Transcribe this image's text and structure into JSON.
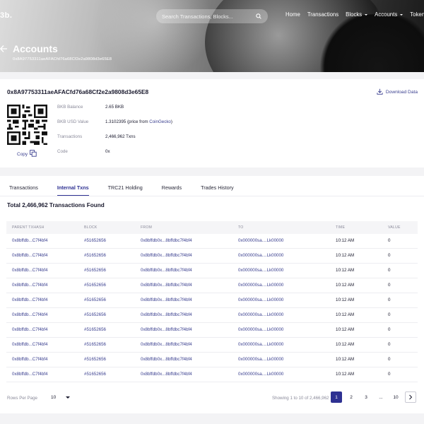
{
  "header": {
    "logo": "3b.",
    "search_placeholder": "Search Transactions, Blocks...",
    "nav": [
      {
        "label": "Home",
        "dropdown": false
      },
      {
        "label": "Transactions",
        "dropdown": false
      },
      {
        "label": "Blocks",
        "dropdown": true
      },
      {
        "label": "Accounts",
        "dropdown": true
      },
      {
        "label": "Tokens",
        "dropdown": true
      }
    ],
    "title": "Accounts",
    "subtitle": "0x8A97753311aeAFACfd76a68Cf2e2a9808d3e65E8"
  },
  "account": {
    "address": "0x8A97753311aeAFACfd76a68Cf2e2a9808d3e65E8",
    "download_label": "Download Data",
    "copy_label": "Copy",
    "rows": [
      {
        "key": "BKB Balance",
        "value": "2.65 BKB"
      },
      {
        "key": "BKB USD Value",
        "value": "1.3102395 (price from ",
        "link": "CoinGecko",
        "after": ")"
      },
      {
        "key": "Transactions",
        "value": "2,466,962 Txns"
      },
      {
        "key": "Code",
        "value": "0x"
      }
    ]
  },
  "tabs": [
    {
      "label": "Transactions",
      "active": false
    },
    {
      "label": "Internal Txns",
      "active": true
    },
    {
      "label": "TRC21 Holding",
      "active": false
    },
    {
      "label": "Rewards",
      "active": false
    },
    {
      "label": "Trades History",
      "active": false
    }
  ],
  "total_label": "Total 2,466,962 Transactions Found",
  "table": {
    "columns": [
      "PARENT TXHASH",
      "BLOCK",
      "FROM",
      "TO",
      "TIME",
      "VALUE"
    ],
    "rows": [
      [
        "0x8bffdb...C7f4bf4",
        "#51652656",
        "0x8bffdb0x...8bffdbc7f4bf4",
        "0x000000sa....Lk00000",
        "10:12 AM",
        "0"
      ],
      [
        "0x8bffdb...C7f4bf4",
        "#51652656",
        "0x8bffdb0x...8bffdbc7f4bf4",
        "0x000000sa....Lk00000",
        "10:12 AM",
        "0"
      ],
      [
        "0x8bffdb...C7f4bf4",
        "#51652656",
        "0x8bffdb0x...8bffdbc7f4bf4",
        "0x000000sa....Lk00000",
        "10:12 AM",
        "0"
      ],
      [
        "0x8bffdb...C7f4bf4",
        "#51652656",
        "0x8bffdb0x...8bffdbc7f4bf4",
        "0x000000sa....Lk00000",
        "10:12 AM",
        "0"
      ],
      [
        "0x8bffdb...C7f4bf4",
        "#51652656",
        "0x8bffdb0x...8bffdbc7f4bf4",
        "0x000000sa....Lk00000",
        "10:12 AM",
        "0"
      ],
      [
        "0x8bffdb...C7f4bf4",
        "#51652656",
        "0x8bffdb0x...8bffdbc7f4bf4",
        "0x000000sa....Lk00000",
        "10:12 AM",
        "0"
      ],
      [
        "0x8bffdb...C7f4bf4",
        "#51652656",
        "0x8bffdb0x...8bffdbc7f4bf4",
        "0x000000sa....Lk00000",
        "10:12 AM",
        "0"
      ],
      [
        "0x8bffdb...C7f4bf4",
        "#51652656",
        "0x8bffdb0x...8bffdbc7f4bf4",
        "0x000000sa....Lk00000",
        "10:12 AM",
        "0"
      ],
      [
        "0x8bffdb...C7f4bf4",
        "#51652656",
        "0x8bffdb0x...8bffdbc7f4bf4",
        "0x000000sa....Lk00000",
        "10:12 AM",
        "0"
      ],
      [
        "0x8bffdb...C7f4bf4",
        "#51652656",
        "0x8bffdb0x...8bffdbc7f4bf4",
        "0x000000sa....Lk00000",
        "10:12 AM",
        "0"
      ]
    ]
  },
  "pagination": {
    "rows_per_page_label": "Rows Per Page",
    "rows_per_page": "10",
    "showing": "Showing 1 to 10 of 2,466,962",
    "pages": [
      "1",
      "2",
      "3",
      "...",
      "10"
    ],
    "active_page": "1"
  },
  "icons": {
    "search": "search-icon",
    "back": "arrow-left-icon",
    "download": "download-icon",
    "copy": "copy-icon",
    "next": "chevron-right-icon",
    "qr": "qr-code-icon"
  },
  "colors": {
    "accent": "#2e3192",
    "link": "#3a3f8f",
    "background": "#f3f3f5"
  }
}
